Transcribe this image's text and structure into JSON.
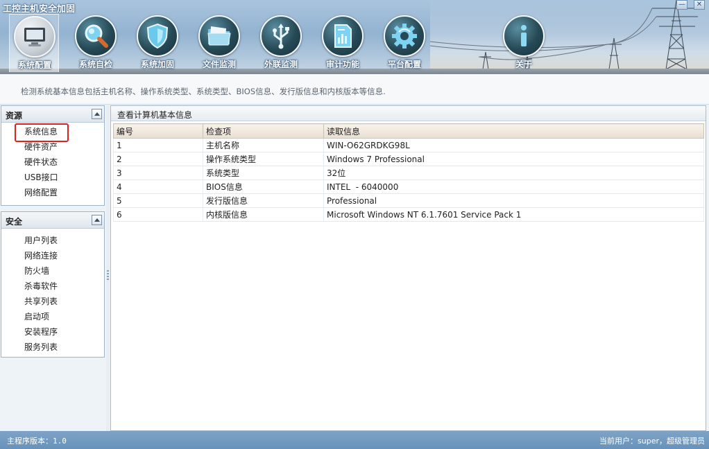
{
  "window": {
    "title": "工控主机安全加固",
    "minimize_label": "—",
    "close_label": "✕"
  },
  "nav": {
    "items": [
      {
        "label": "系统配置",
        "icon": "monitor-icon",
        "active": true
      },
      {
        "label": "系统自检",
        "icon": "magnifier-icon",
        "active": false
      },
      {
        "label": "系统加固",
        "icon": "shield-icon",
        "active": false
      },
      {
        "label": "文件监测",
        "icon": "folder-icon",
        "active": false
      },
      {
        "label": "外联监测",
        "icon": "usb-icon",
        "active": false
      },
      {
        "label": "审计功能",
        "icon": "audit-document-icon",
        "active": false
      },
      {
        "label": "平台配置",
        "icon": "gear-icon",
        "active": false
      },
      {
        "label": "关于",
        "icon": "info-icon",
        "active": false
      }
    ]
  },
  "description": "检测系统基本信息包括主机名称、操作系统类型、系统类型、BIOS信息、发行版信息和内核版本等信息.",
  "sidebar": {
    "resources": {
      "title": "资源",
      "items": [
        {
          "label": "系统信息",
          "selected": true
        },
        {
          "label": "硬件资产",
          "selected": false
        },
        {
          "label": "硬件状态",
          "selected": false
        },
        {
          "label": "USB接口",
          "selected": false
        },
        {
          "label": "网络配置",
          "selected": false
        }
      ]
    },
    "security": {
      "title": "安全",
      "items": [
        {
          "label": "用户列表"
        },
        {
          "label": "网络连接"
        },
        {
          "label": "防火墙"
        },
        {
          "label": "杀毒软件"
        },
        {
          "label": "共享列表"
        },
        {
          "label": "启动项"
        },
        {
          "label": "安装程序"
        },
        {
          "label": "服务列表"
        }
      ]
    }
  },
  "main": {
    "title": "查看计算机基本信息",
    "columns": [
      "编号",
      "检查项",
      "读取信息"
    ],
    "rows": [
      [
        "1",
        "主机名称",
        "WIN-O62GRDKG98L"
      ],
      [
        "2",
        "操作系统类型",
        "Windows 7 Professional"
      ],
      [
        "3",
        "系统类型",
        "32位"
      ],
      [
        "4",
        "BIOS信息",
        "INTEL  - 6040000"
      ],
      [
        "5",
        "发行版信息",
        "Professional"
      ],
      [
        "6",
        "内核版信息",
        "Microsoft Windows NT 6.1.7601 Service Pack 1"
      ]
    ]
  },
  "status": {
    "version": "主程序版本：1.0",
    "user": "当前用户：super，超级管理员"
  },
  "colors": {
    "header": "#93b3d1",
    "statusbar": "#6f97bf",
    "selection_outline": "#e0201c"
  }
}
